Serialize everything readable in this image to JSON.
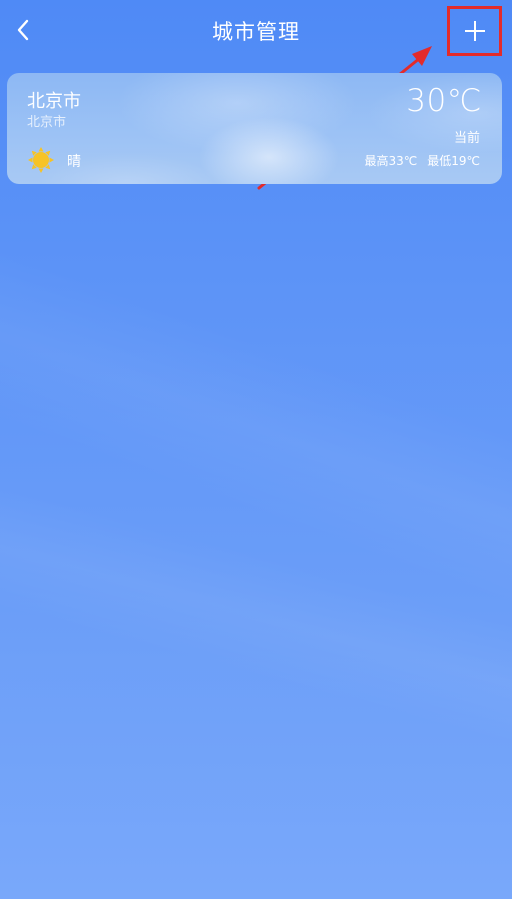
{
  "header": {
    "title": "城市管理",
    "back_icon": "chevron-left-icon",
    "add_icon": "plus-icon",
    "highlight_color": "#e32b2b"
  },
  "cities": [
    {
      "name": "北京市",
      "subtitle": "北京市",
      "weather_icon": "sun-icon",
      "weather": "晴",
      "temperature": "30℃",
      "now_label": "当前",
      "high": "最高33℃",
      "low": "最低19℃"
    }
  ],
  "colors": {
    "background_top": "#4f8af6",
    "background_bottom": "#79a8fa",
    "sun": "#f7c325",
    "annotation_red": "#e32b2b"
  }
}
